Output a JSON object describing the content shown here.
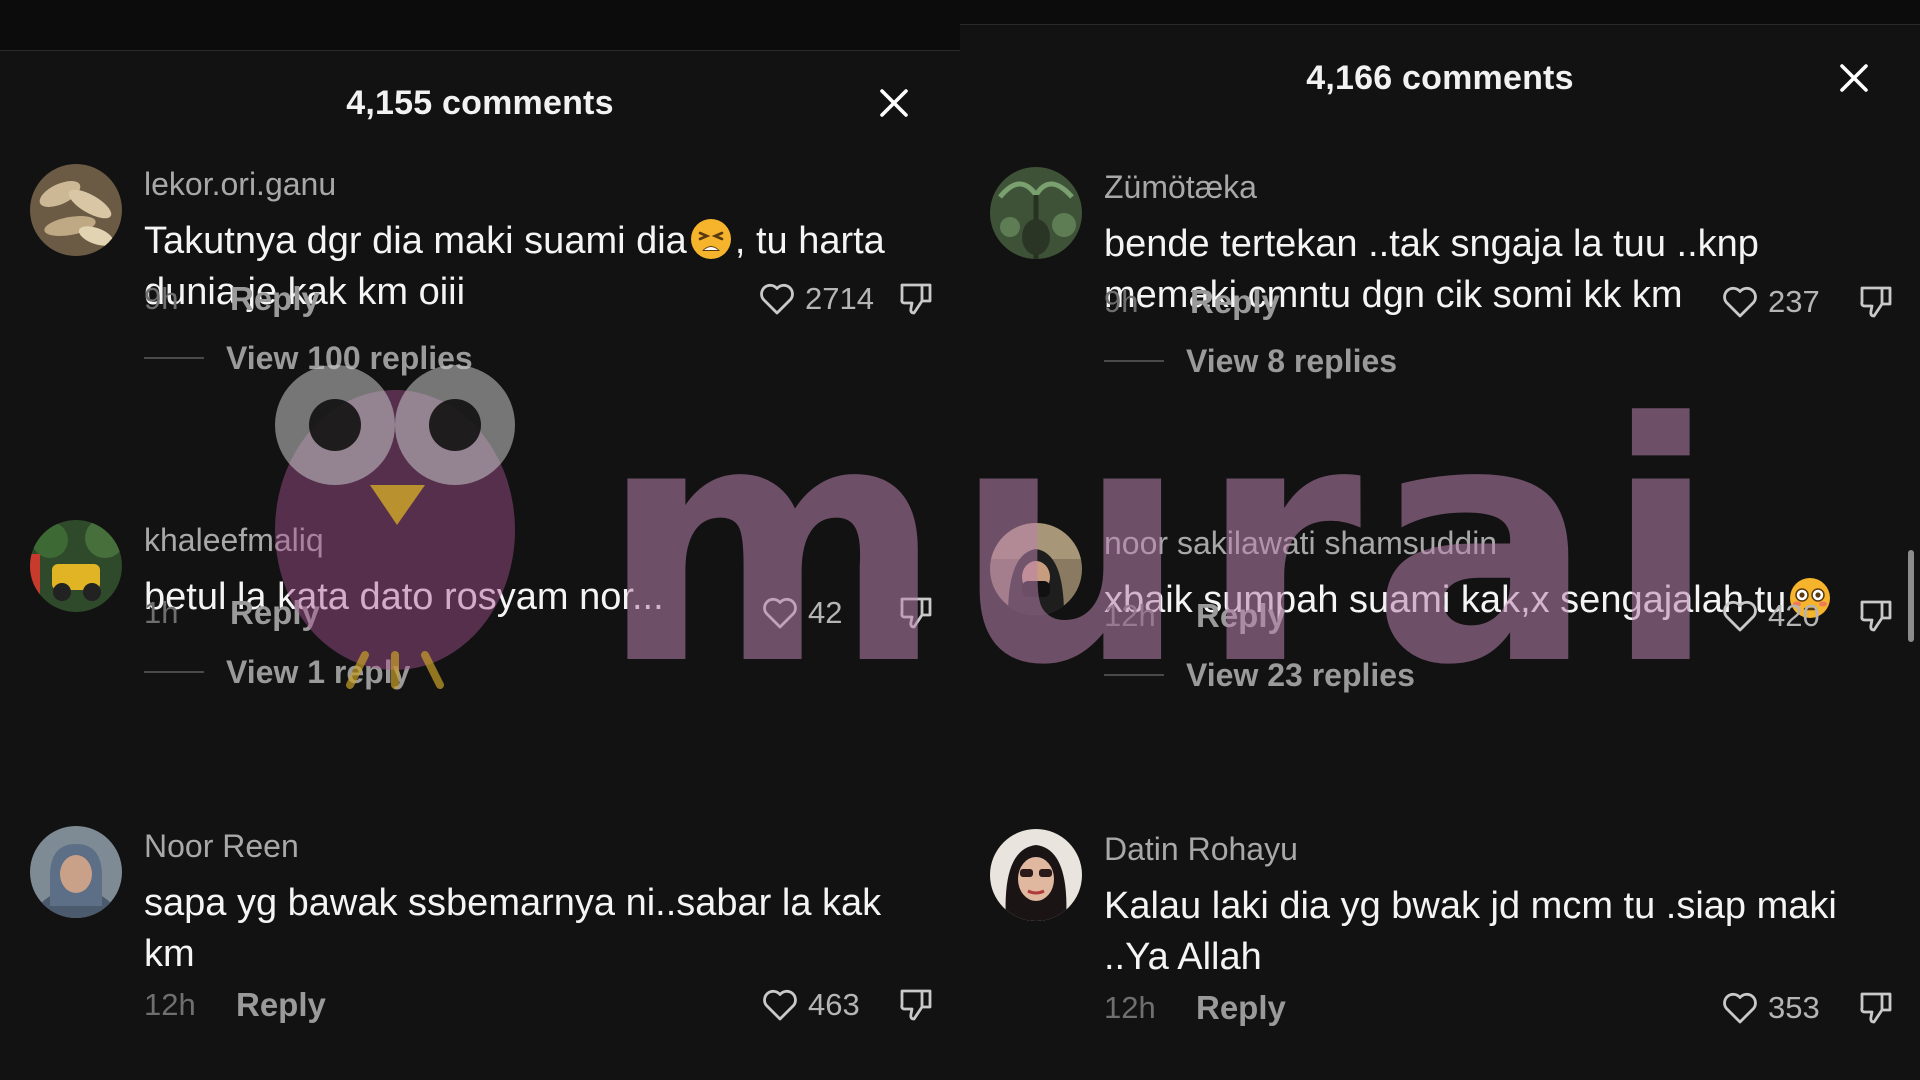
{
  "panels": [
    {
      "title": "4,155 comments",
      "comments": [
        {
          "username": "lekor.ori.ganu",
          "text_before": "Takutnya dgr dia maki suami dia",
          "emoji": "tired-face-emoji",
          "text_after": ", tu harta dunia je kak km oiii",
          "time": "9h",
          "reply": "Reply",
          "likes": "2714",
          "view_replies": "View 100 replies"
        },
        {
          "username": "khaleefmaliq",
          "text_before": "betul la kata dato rosyam nor...",
          "emoji": "",
          "text_after": "",
          "time": "1h",
          "reply": "Reply",
          "likes": "42",
          "view_replies": "View 1 reply"
        },
        {
          "username": "Noor Reen",
          "text_before": "sapa yg bawak ssbemarnya ni..sabar la kak km",
          "emoji": "",
          "text_after": "",
          "time": "12h",
          "reply": "Reply",
          "likes": "463",
          "view_replies": ""
        }
      ]
    },
    {
      "title": "4,166 comments",
      "comments": [
        {
          "username": "Zümötæka",
          "text_before": "bende tertekan ..tak sngaja la tuu ..knp memaki cmntu dgn cik somi kk km",
          "emoji": "",
          "text_after": "",
          "time": "9h",
          "reply": "Reply",
          "likes": "237",
          "view_replies": "View 8 replies"
        },
        {
          "username": "noor sakilawati  shamsuddin",
          "text_before": "xbaik sumpah suami kak,x sengajalah tu",
          "emoji": "flushed-face-emoji",
          "text_after": "",
          "time": "12h",
          "reply": "Reply",
          "likes": "420",
          "view_replies": "View 23 replies"
        },
        {
          "username": "Datin Rohayu",
          "text_before": "Kalau laki dia yg bwak jd mcm tu .siap maki ..Ya Allah",
          "emoji": "",
          "text_after": "",
          "time": "12h",
          "reply": "Reply",
          "likes": "353",
          "view_replies": ""
        }
      ]
    }
  ],
  "watermark": {
    "text": "murai",
    "color": "#b982af"
  },
  "colors": {
    "background": "#121212",
    "text_primary": "#f4f4f4",
    "text_secondary": "#a8a8a8",
    "text_muted": "#6f6f6f"
  }
}
